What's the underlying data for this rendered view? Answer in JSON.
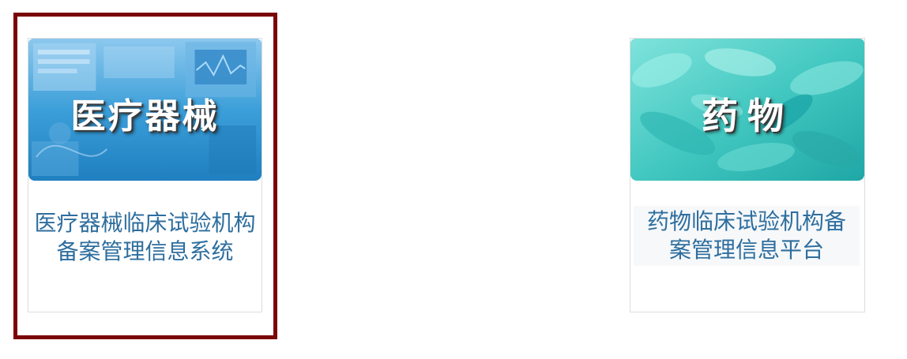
{
  "cards": [
    {
      "banner_title": "医疗器械",
      "caption": "医疗器械临床试验机构备案管理信息系统",
      "theme": "blue",
      "selected": true
    },
    {
      "banner_title": "药物",
      "caption": "药物临床试验机构备案管理信息平台",
      "theme": "teal",
      "selected": false
    }
  ],
  "colors": {
    "selection_border": "#7a0406",
    "caption_text": "#2e6e9e",
    "device_banner": "#2a8fce",
    "drug_banner": "#3fc9c2"
  }
}
